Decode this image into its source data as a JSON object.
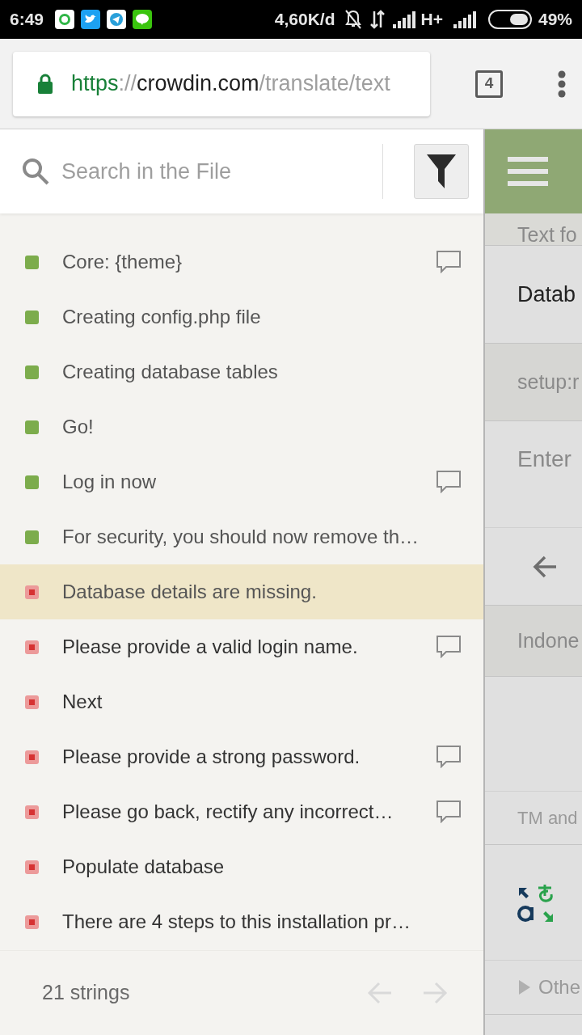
{
  "status_bar": {
    "time": "6:49",
    "apps": [
      {
        "kind": "whatsapp"
      },
      {
        "kind": "twitter"
      },
      {
        "kind": "telegram"
      },
      {
        "kind": "line"
      }
    ],
    "speed": "4,60K/d",
    "network": "H+",
    "battery_percent": "49%"
  },
  "browser": {
    "url": {
      "scheme": "https",
      "separator": "://",
      "host": "crowdin.com",
      "path": "/translate/text"
    },
    "tab_count": "4"
  },
  "search": {
    "placeholder": "Search in the File"
  },
  "strings": [
    {
      "text": "Core: {theme}",
      "kind": "translated",
      "comment": true,
      "selected": false
    },
    {
      "text": "Creating config.php file",
      "kind": "translated",
      "comment": false,
      "selected": false
    },
    {
      "text": "Creating database tables",
      "kind": "translated",
      "comment": false,
      "selected": false
    },
    {
      "text": "Go!",
      "kind": "translated",
      "comment": false,
      "selected": false
    },
    {
      "text": "Log in now",
      "kind": "translated",
      "comment": true,
      "selected": false
    },
    {
      "text": "For security, you should now remove th…",
      "kind": "translated",
      "comment": false,
      "selected": false
    },
    {
      "text": "Database details are missing.",
      "kind": "untranslated",
      "comment": false,
      "selected": true
    },
    {
      "text": "Please provide a valid login name.",
      "kind": "untranslated",
      "comment": true,
      "selected": false
    },
    {
      "text": "Next",
      "kind": "untranslated",
      "comment": false,
      "selected": false
    },
    {
      "text": "Please provide a strong password.",
      "kind": "untranslated",
      "comment": true,
      "selected": false
    },
    {
      "text": "Please go back, rectify any incorrect…",
      "kind": "untranslated",
      "comment": true,
      "selected": false
    },
    {
      "text": "Populate database",
      "kind": "untranslated",
      "comment": false,
      "selected": false
    },
    {
      "text": "There are 4 steps to this installation pr…",
      "kind": "untranslated",
      "comment": false,
      "selected": false
    }
  ],
  "footer": {
    "count": "21 strings"
  },
  "editor": {
    "section_label": "Text fo",
    "source_text": "Datab",
    "context": "setup:r",
    "translation_placeholder": "Enter",
    "language": "Indone",
    "suggestions_label": "TM and",
    "other_label": "Othe"
  }
}
